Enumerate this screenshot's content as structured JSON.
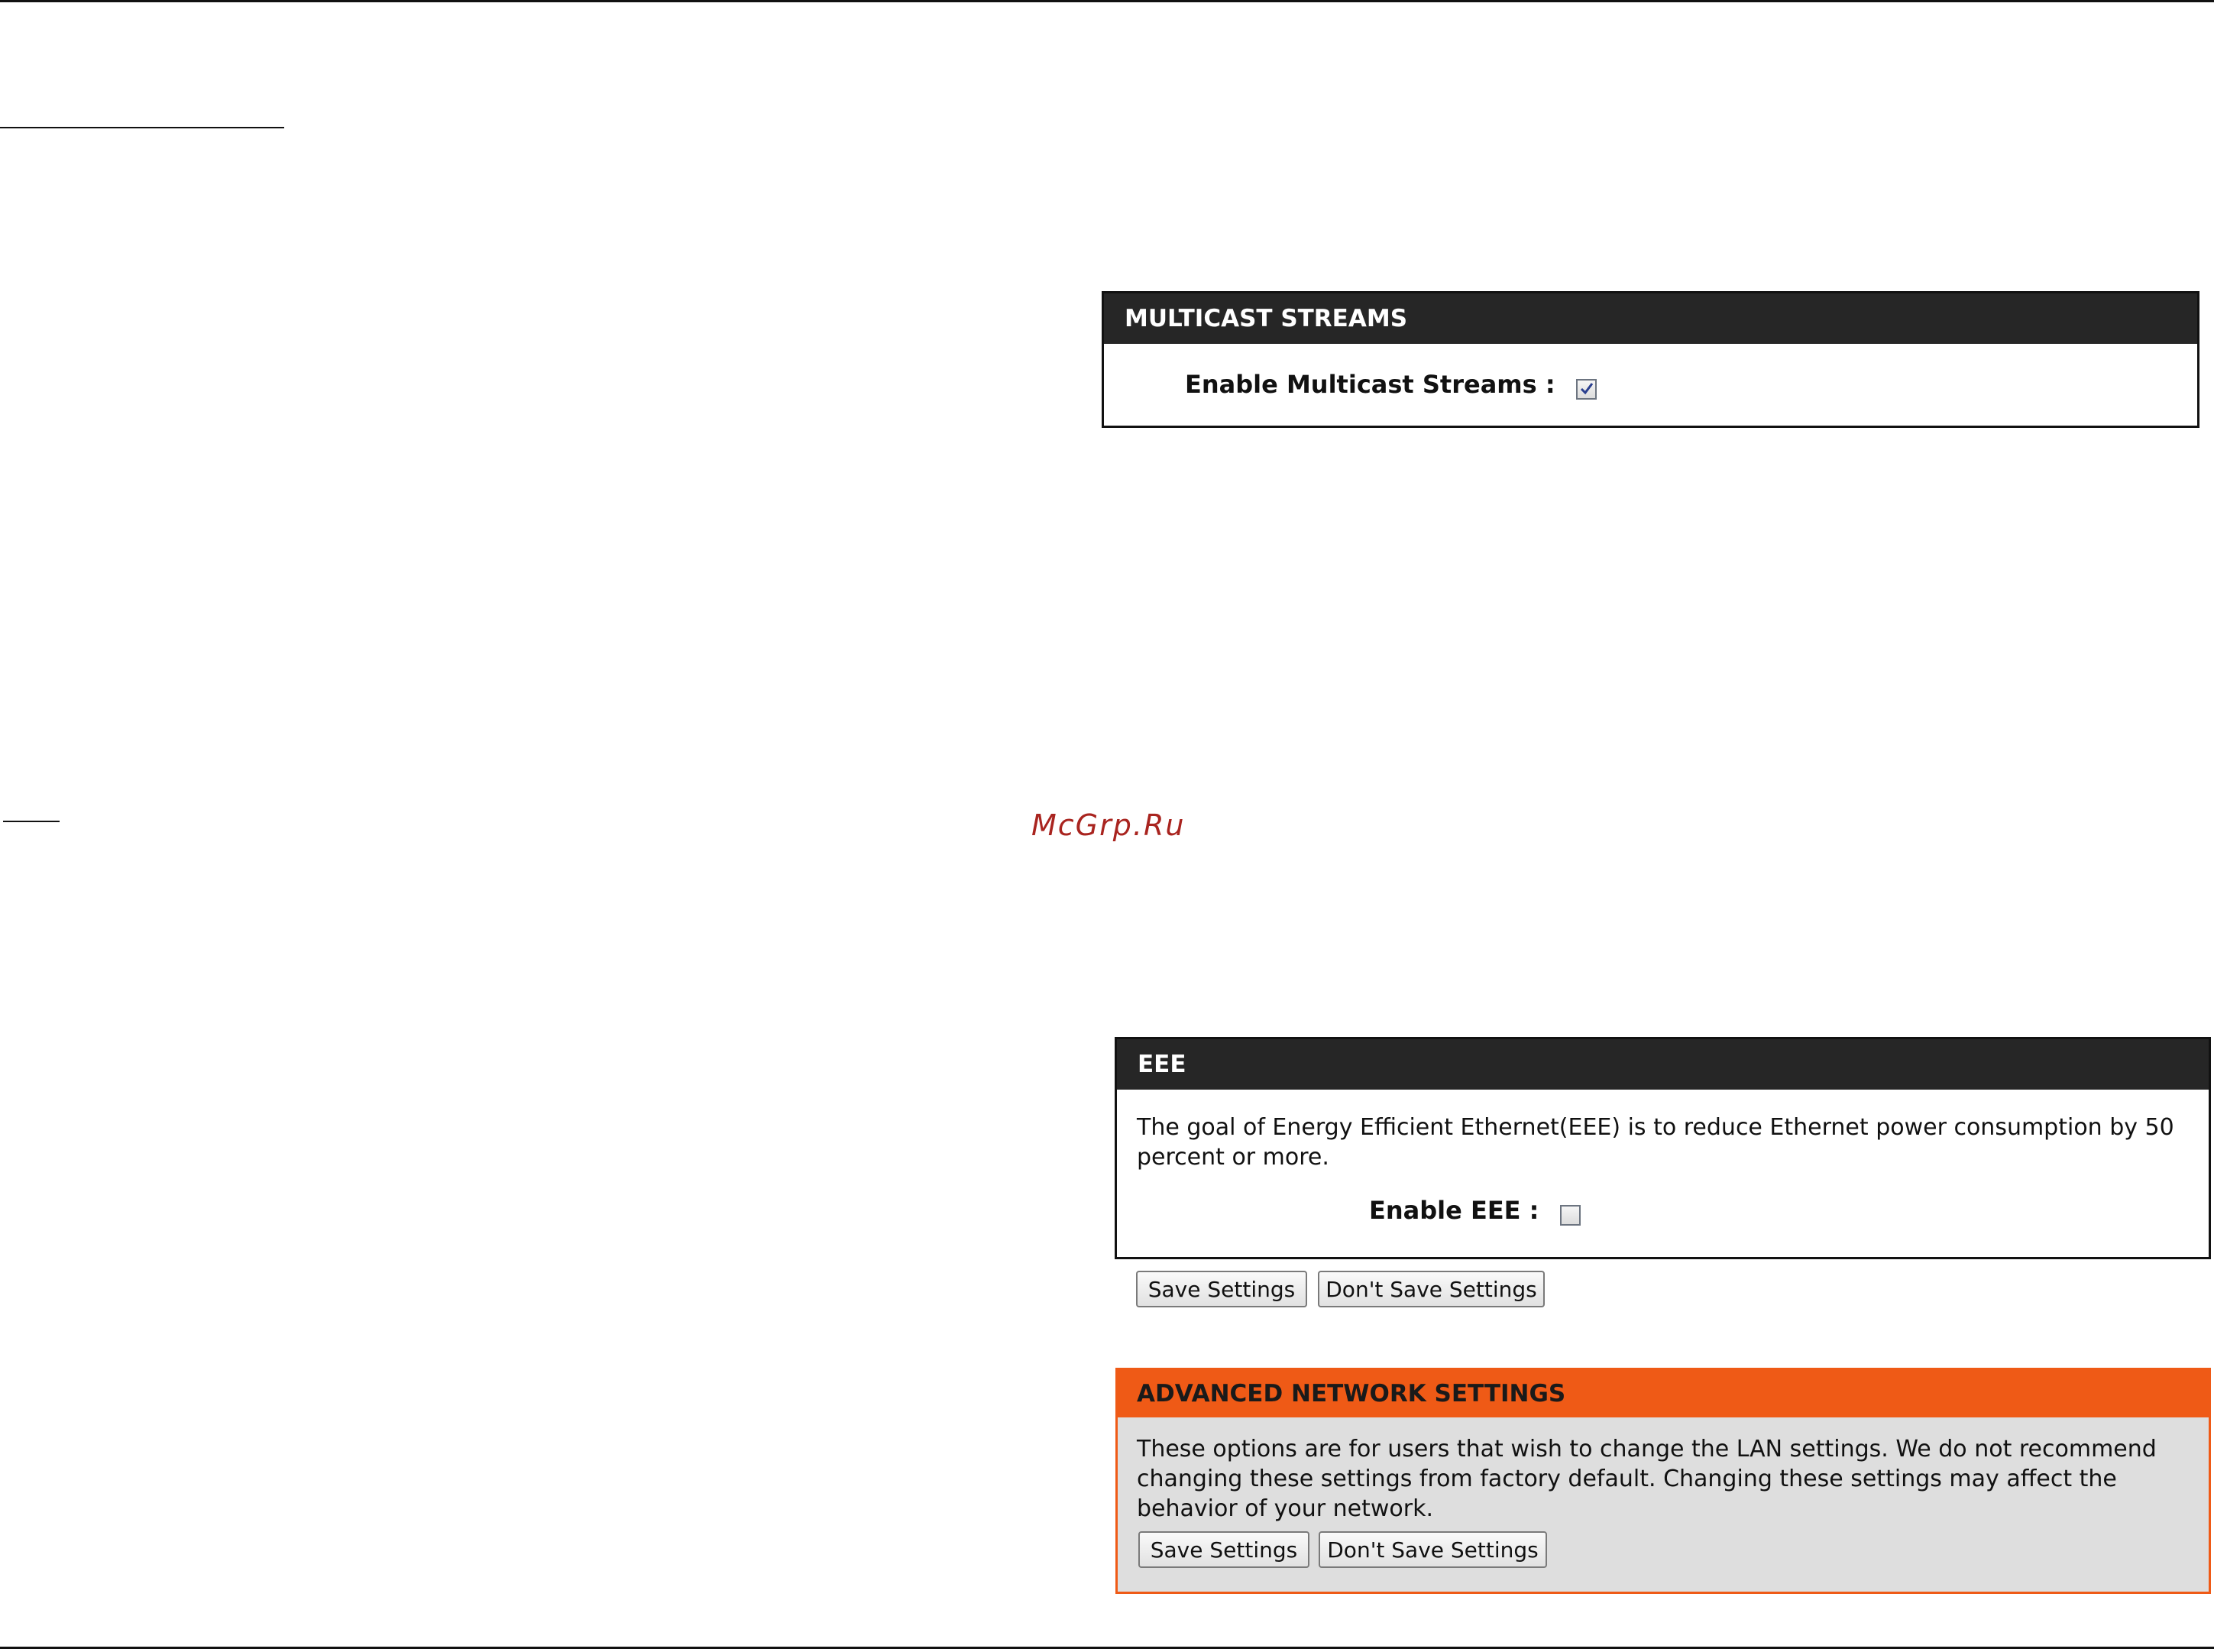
{
  "watermark": "McGrp.Ru",
  "multicast": {
    "title": "MULTICAST STREAMS",
    "label": "Enable Multicast Streams :",
    "checked": true
  },
  "eee": {
    "title": "EEE",
    "description": "The goal of Energy Efficient Ethernet(EEE) is to reduce Ethernet power consumption by 50 percent or more.",
    "label": "Enable EEE :",
    "checked": false
  },
  "buttons": {
    "save": "Save Settings",
    "dont_save": "Don't Save Settings"
  },
  "advanced": {
    "title": "ADVANCED NETWORK SETTINGS",
    "description": "These options are for users that wish to change the LAN settings. We do not recommend changing these settings from factory default. Changing these settings may affect the behavior of your network."
  },
  "colors": {
    "header_dark": "#262626",
    "header_orange": "#ef5a16",
    "panel_gray": "#dedede",
    "watermark": "#a9241f"
  }
}
